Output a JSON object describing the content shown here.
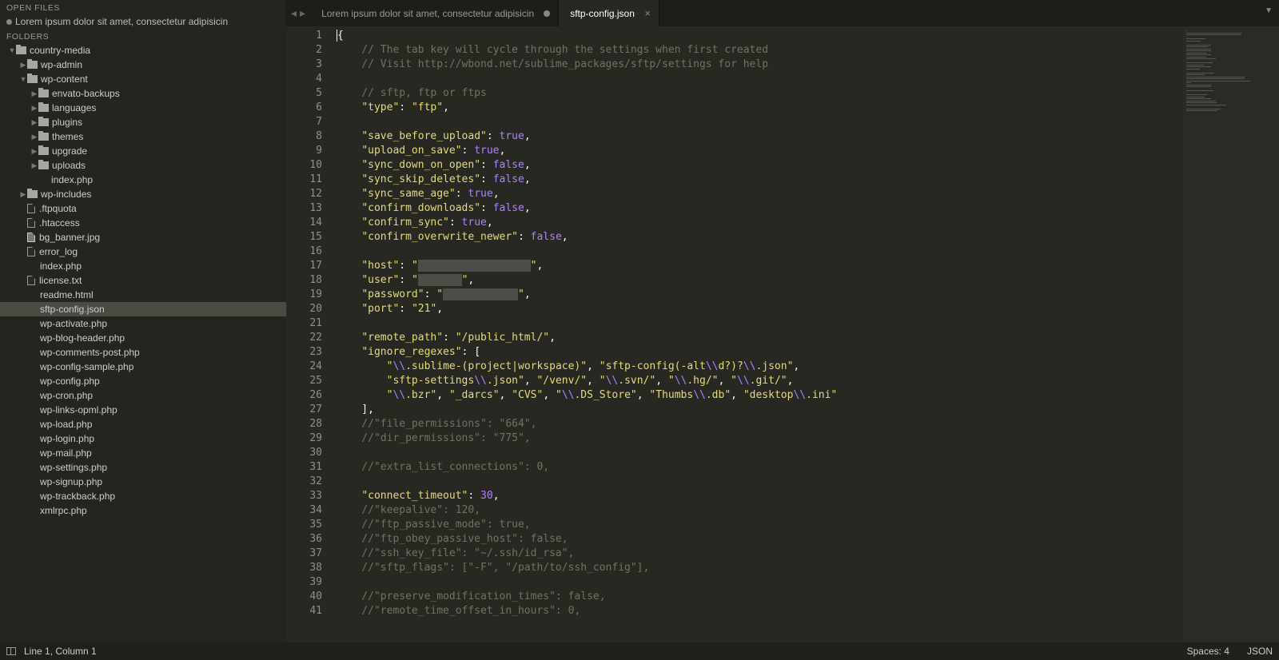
{
  "sidebar": {
    "open_files_header": "OPEN FILES",
    "open_file": "Lorem ipsum dolor sit amet, consectetur adipisicin",
    "folders_header": "FOLDERS",
    "tree": [
      {
        "depth": 0,
        "type": "folder",
        "open": true,
        "name": "country-media"
      },
      {
        "depth": 1,
        "type": "folder",
        "open": false,
        "name": "wp-admin"
      },
      {
        "depth": 1,
        "type": "folder",
        "open": true,
        "name": "wp-content"
      },
      {
        "depth": 2,
        "type": "folder",
        "open": false,
        "name": "envato-backups"
      },
      {
        "depth": 2,
        "type": "folder",
        "open": false,
        "name": "languages"
      },
      {
        "depth": 2,
        "type": "folder",
        "open": false,
        "name": "plugins"
      },
      {
        "depth": 2,
        "type": "folder",
        "open": false,
        "name": "themes"
      },
      {
        "depth": 2,
        "type": "folder",
        "open": false,
        "name": "upgrade"
      },
      {
        "depth": 2,
        "type": "folder",
        "open": false,
        "name": "uploads"
      },
      {
        "depth": 2,
        "type": "file",
        "name": "index.php",
        "noicon": true
      },
      {
        "depth": 1,
        "type": "folder",
        "open": false,
        "name": "wp-includes"
      },
      {
        "depth": 1,
        "type": "file",
        "icon": "doc",
        "name": ".ftpquota"
      },
      {
        "depth": 1,
        "type": "file",
        "icon": "doc",
        "name": ".htaccess"
      },
      {
        "depth": 1,
        "type": "file",
        "icon": "img",
        "name": "bg_banner.jpg"
      },
      {
        "depth": 1,
        "type": "file",
        "icon": "doc",
        "name": "error_log"
      },
      {
        "depth": 1,
        "type": "file",
        "name": "index.php",
        "noicon": true
      },
      {
        "depth": 1,
        "type": "file",
        "icon": "doc",
        "name": "license.txt"
      },
      {
        "depth": 1,
        "type": "file",
        "name": "readme.html",
        "noicon": true
      },
      {
        "depth": 1,
        "type": "file",
        "name": "sftp-config.json",
        "selected": true,
        "noicon": true
      },
      {
        "depth": 1,
        "type": "file",
        "name": "wp-activate.php",
        "noicon": true
      },
      {
        "depth": 1,
        "type": "file",
        "name": "wp-blog-header.php",
        "noicon": true
      },
      {
        "depth": 1,
        "type": "file",
        "name": "wp-comments-post.php",
        "noicon": true
      },
      {
        "depth": 1,
        "type": "file",
        "name": "wp-config-sample.php",
        "noicon": true
      },
      {
        "depth": 1,
        "type": "file",
        "name": "wp-config.php",
        "noicon": true
      },
      {
        "depth": 1,
        "type": "file",
        "name": "wp-cron.php",
        "noicon": true
      },
      {
        "depth": 1,
        "type": "file",
        "name": "wp-links-opml.php",
        "noicon": true
      },
      {
        "depth": 1,
        "type": "file",
        "name": "wp-load.php",
        "noicon": true
      },
      {
        "depth": 1,
        "type": "file",
        "name": "wp-login.php",
        "noicon": true
      },
      {
        "depth": 1,
        "type": "file",
        "name": "wp-mail.php",
        "noicon": true
      },
      {
        "depth": 1,
        "type": "file",
        "name": "wp-settings.php",
        "noicon": true
      },
      {
        "depth": 1,
        "type": "file",
        "name": "wp-signup.php",
        "noicon": true
      },
      {
        "depth": 1,
        "type": "file",
        "name": "wp-trackback.php",
        "noicon": true
      },
      {
        "depth": 1,
        "type": "file",
        "name": "xmlrpc.php",
        "noicon": true
      }
    ]
  },
  "tabs": [
    {
      "label": "Lorem ipsum dolor sit amet, consectetur adipisicin",
      "active": false,
      "dirty": true
    },
    {
      "label": "sftp-config.json",
      "active": true,
      "dirty": false
    }
  ],
  "code_lines": [
    [
      {
        "t": "plain",
        "v": "{"
      }
    ],
    [
      {
        "t": "comment",
        "v": "    // The tab key will cycle through the settings when first created"
      }
    ],
    [
      {
        "t": "comment",
        "v": "    // Visit http://wbond.net/sublime_packages/sftp/settings for help"
      }
    ],
    [],
    [
      {
        "t": "comment",
        "v": "    // sftp, ftp or ftps"
      }
    ],
    [
      {
        "t": "plain",
        "v": "    "
      },
      {
        "t": "key",
        "v": "\"type\""
      },
      {
        "t": "plain",
        "v": ": "
      },
      {
        "t": "str",
        "v": "\"ftp\""
      },
      {
        "t": "plain",
        "v": ","
      }
    ],
    [],
    [
      {
        "t": "plain",
        "v": "    "
      },
      {
        "t": "key",
        "v": "\"save_before_upload\""
      },
      {
        "t": "plain",
        "v": ": "
      },
      {
        "t": "bool",
        "v": "true"
      },
      {
        "t": "plain",
        "v": ","
      }
    ],
    [
      {
        "t": "plain",
        "v": "    "
      },
      {
        "t": "key",
        "v": "\"upload_on_save\""
      },
      {
        "t": "plain",
        "v": ": "
      },
      {
        "t": "bool",
        "v": "true"
      },
      {
        "t": "plain",
        "v": ","
      }
    ],
    [
      {
        "t": "plain",
        "v": "    "
      },
      {
        "t": "key",
        "v": "\"sync_down_on_open\""
      },
      {
        "t": "plain",
        "v": ": "
      },
      {
        "t": "bool",
        "v": "false"
      },
      {
        "t": "plain",
        "v": ","
      }
    ],
    [
      {
        "t": "plain",
        "v": "    "
      },
      {
        "t": "key",
        "v": "\"sync_skip_deletes\""
      },
      {
        "t": "plain",
        "v": ": "
      },
      {
        "t": "bool",
        "v": "false"
      },
      {
        "t": "plain",
        "v": ","
      }
    ],
    [
      {
        "t": "plain",
        "v": "    "
      },
      {
        "t": "key",
        "v": "\"sync_same_age\""
      },
      {
        "t": "plain",
        "v": ": "
      },
      {
        "t": "bool",
        "v": "true"
      },
      {
        "t": "plain",
        "v": ","
      }
    ],
    [
      {
        "t": "plain",
        "v": "    "
      },
      {
        "t": "key",
        "v": "\"confirm_downloads\""
      },
      {
        "t": "plain",
        "v": ": "
      },
      {
        "t": "bool",
        "v": "false"
      },
      {
        "t": "plain",
        "v": ","
      }
    ],
    [
      {
        "t": "plain",
        "v": "    "
      },
      {
        "t": "key",
        "v": "\"confirm_sync\""
      },
      {
        "t": "plain",
        "v": ": "
      },
      {
        "t": "bool",
        "v": "true"
      },
      {
        "t": "plain",
        "v": ","
      }
    ],
    [
      {
        "t": "plain",
        "v": "    "
      },
      {
        "t": "key",
        "v": "\"confirm_overwrite_newer\""
      },
      {
        "t": "plain",
        "v": ": "
      },
      {
        "t": "bool",
        "v": "false"
      },
      {
        "t": "plain",
        "v": ","
      }
    ],
    [],
    [
      {
        "t": "plain",
        "v": "    "
      },
      {
        "t": "key",
        "v": "\"host\""
      },
      {
        "t": "plain",
        "v": ": "
      },
      {
        "t": "str",
        "v": "\""
      },
      {
        "t": "redact",
        "v": "xxxxxxxxxxxxxxxxxx"
      },
      {
        "t": "str",
        "v": "\""
      },
      {
        "t": "plain",
        "v": ","
      }
    ],
    [
      {
        "t": "plain",
        "v": "    "
      },
      {
        "t": "key",
        "v": "\"user\""
      },
      {
        "t": "plain",
        "v": ": "
      },
      {
        "t": "str",
        "v": "\""
      },
      {
        "t": "redact",
        "v": "xxxxxxx"
      },
      {
        "t": "str",
        "v": "\""
      },
      {
        "t": "plain",
        "v": ","
      }
    ],
    [
      {
        "t": "plain",
        "v": "    "
      },
      {
        "t": "key",
        "v": "\"password\""
      },
      {
        "t": "plain",
        "v": ": "
      },
      {
        "t": "str",
        "v": "\""
      },
      {
        "t": "redact",
        "v": "xxxxxxxxxxxx"
      },
      {
        "t": "str",
        "v": "\""
      },
      {
        "t": "plain",
        "v": ","
      }
    ],
    [
      {
        "t": "plain",
        "v": "    "
      },
      {
        "t": "key",
        "v": "\"port\""
      },
      {
        "t": "plain",
        "v": ": "
      },
      {
        "t": "str",
        "v": "\"21\""
      },
      {
        "t": "plain",
        "v": ","
      }
    ],
    [],
    [
      {
        "t": "plain",
        "v": "    "
      },
      {
        "t": "key",
        "v": "\"remote_path\""
      },
      {
        "t": "plain",
        "v": ": "
      },
      {
        "t": "str",
        "v": "\"/public_html/\""
      },
      {
        "t": "plain",
        "v": ","
      }
    ],
    [
      {
        "t": "plain",
        "v": "    "
      },
      {
        "t": "key",
        "v": "\"ignore_regexes\""
      },
      {
        "t": "plain",
        "v": ": ["
      }
    ],
    [
      {
        "t": "plain",
        "v": "        "
      },
      {
        "t": "str",
        "v": "\""
      },
      {
        "t": "esc",
        "v": "\\\\"
      },
      {
        "t": "str",
        "v": ".sublime-(project|workspace)\""
      },
      {
        "t": "plain",
        "v": ", "
      },
      {
        "t": "str",
        "v": "\"sftp-config(-alt"
      },
      {
        "t": "esc",
        "v": "\\\\"
      },
      {
        "t": "str",
        "v": "d?)?"
      },
      {
        "t": "esc",
        "v": "\\\\"
      },
      {
        "t": "str",
        "v": ".json\""
      },
      {
        "t": "plain",
        "v": ","
      }
    ],
    [
      {
        "t": "plain",
        "v": "        "
      },
      {
        "t": "str",
        "v": "\"sftp-settings"
      },
      {
        "t": "esc",
        "v": "\\\\"
      },
      {
        "t": "str",
        "v": ".json\""
      },
      {
        "t": "plain",
        "v": ", "
      },
      {
        "t": "str",
        "v": "\"/venv/\""
      },
      {
        "t": "plain",
        "v": ", "
      },
      {
        "t": "str",
        "v": "\""
      },
      {
        "t": "esc",
        "v": "\\\\"
      },
      {
        "t": "str",
        "v": ".svn/\""
      },
      {
        "t": "plain",
        "v": ", "
      },
      {
        "t": "str",
        "v": "\""
      },
      {
        "t": "esc",
        "v": "\\\\"
      },
      {
        "t": "str",
        "v": ".hg/\""
      },
      {
        "t": "plain",
        "v": ", "
      },
      {
        "t": "str",
        "v": "\""
      },
      {
        "t": "esc",
        "v": "\\\\"
      },
      {
        "t": "str",
        "v": ".git/\""
      },
      {
        "t": "plain",
        "v": ","
      }
    ],
    [
      {
        "t": "plain",
        "v": "        "
      },
      {
        "t": "str",
        "v": "\""
      },
      {
        "t": "esc",
        "v": "\\\\"
      },
      {
        "t": "str",
        "v": ".bzr\""
      },
      {
        "t": "plain",
        "v": ", "
      },
      {
        "t": "str",
        "v": "\"_darcs\""
      },
      {
        "t": "plain",
        "v": ", "
      },
      {
        "t": "str",
        "v": "\"CVS\""
      },
      {
        "t": "plain",
        "v": ", "
      },
      {
        "t": "str",
        "v": "\""
      },
      {
        "t": "esc",
        "v": "\\\\"
      },
      {
        "t": "str",
        "v": ".DS_Store\""
      },
      {
        "t": "plain",
        "v": ", "
      },
      {
        "t": "str",
        "v": "\"Thumbs"
      },
      {
        "t": "esc",
        "v": "\\\\"
      },
      {
        "t": "str",
        "v": ".db\""
      },
      {
        "t": "plain",
        "v": ", "
      },
      {
        "t": "str",
        "v": "\"desktop"
      },
      {
        "t": "esc",
        "v": "\\\\"
      },
      {
        "t": "str",
        "v": ".ini\""
      }
    ],
    [
      {
        "t": "plain",
        "v": "    ],"
      }
    ],
    [
      {
        "t": "comment",
        "v": "    //\"file_permissions\": \"664\","
      }
    ],
    [
      {
        "t": "comment",
        "v": "    //\"dir_permissions\": \"775\","
      }
    ],
    [],
    [
      {
        "t": "comment",
        "v": "    //\"extra_list_connections\": 0,"
      }
    ],
    [],
    [
      {
        "t": "plain",
        "v": "    "
      },
      {
        "t": "key",
        "v": "\"connect_timeout\""
      },
      {
        "t": "plain",
        "v": ": "
      },
      {
        "t": "num",
        "v": "30"
      },
      {
        "t": "plain",
        "v": ","
      }
    ],
    [
      {
        "t": "comment",
        "v": "    //\"keepalive\": 120,"
      }
    ],
    [
      {
        "t": "comment",
        "v": "    //\"ftp_passive_mode\": true,"
      }
    ],
    [
      {
        "t": "comment",
        "v": "    //\"ftp_obey_passive_host\": false,"
      }
    ],
    [
      {
        "t": "comment",
        "v": "    //\"ssh_key_file\": \"~/.ssh/id_rsa\","
      }
    ],
    [
      {
        "t": "comment",
        "v": "    //\"sftp_flags\": [\"-F\", \"/path/to/ssh_config\"],"
      }
    ],
    [],
    [
      {
        "t": "comment",
        "v": "    //\"preserve_modification_times\": false,"
      }
    ],
    [
      {
        "t": "comment",
        "v": "    //\"remote_time_offset_in_hours\": 0,"
      }
    ]
  ],
  "status": {
    "position": "Line 1, Column 1",
    "spaces": "Spaces: 4",
    "syntax": "JSON"
  }
}
